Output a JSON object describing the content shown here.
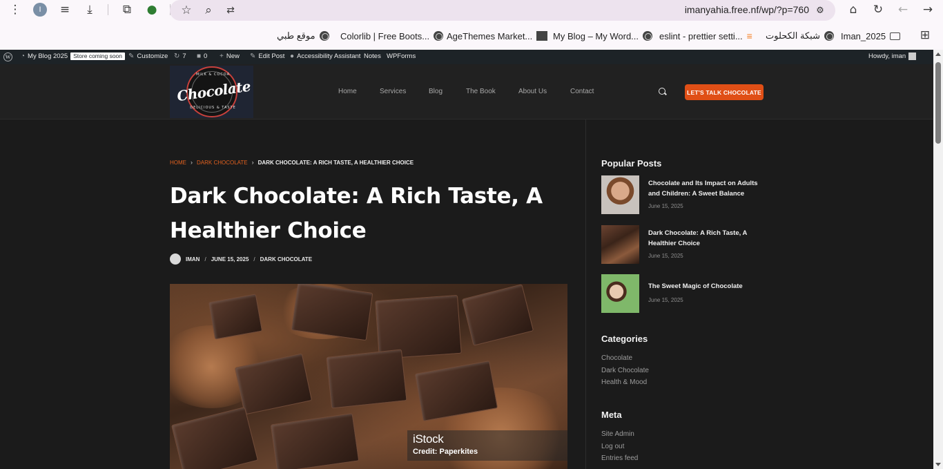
{
  "browser": {
    "profile_initial": "I",
    "url": "imanyahia.free.nf/wp/?p=760",
    "bookmarks": [
      {
        "label": "Iman_2025",
        "icon": "folder-icon"
      },
      {
        "label": "شبكة الكحلوت",
        "icon": "globe-icon"
      },
      {
        "label": "eslint - prettier setti...",
        "icon": "stackoverflow-icon"
      },
      {
        "label": "My Blog – My Word...",
        "icon": "globe-icon"
      },
      {
        "label": "AgeThemes Market...",
        "icon": "square-icon"
      },
      {
        "label": "Colorlib | Free Boots...",
        "icon": "globe-icon"
      },
      {
        "label": "موقع طبي",
        "icon": "globe-icon"
      }
    ]
  },
  "adminbar": {
    "site_name": "My Blog 2025",
    "store_badge": "Store coming soon",
    "customize": "Customize",
    "updates_count": "7",
    "comments_count": "0",
    "new": "New",
    "edit_post": "Edit Post",
    "accessibility": "Accessibility Assistant",
    "notes": "Notes",
    "wpforms": "WPForms",
    "howdy": "Howdy, iman"
  },
  "header": {
    "logo_text": "Chocolate",
    "logo_top": "MILK & COCOA",
    "logo_bottom": "DELICIOUS & TASTE",
    "nav": [
      "Home",
      "Services",
      "Blog",
      "The Book",
      "About Us",
      "Contact"
    ],
    "cta": "LET'S TALK CHOCOLATE"
  },
  "post": {
    "breadcrumb": [
      "HOME",
      "DARK CHOCOLATE",
      "DARK CHOCOLATE: A RICH TASTE, A HEALTHIER CHOICE"
    ],
    "title_line1": "Dark Chocolate: A Rich Taste, A",
    "title_line2": "Healthier Choice",
    "author": "IMAN",
    "date": "JUNE 15, 2025",
    "category": "DARK CHOCOLATE",
    "image_brand": "iStock",
    "image_credit": "Credit: Paperkites"
  },
  "sidebar": {
    "popular_title": "Popular Posts",
    "popular": [
      {
        "title": "Chocolate and Its Impact on Adults and Children: A Sweet Balance",
        "date": "June 15, 2025"
      },
      {
        "title": "Dark Chocolate: A Rich Taste, A Healthier Choice",
        "date": "June 15, 2025"
      },
      {
        "title": "The Sweet Magic of Chocolate",
        "date": "June 15, 2025"
      }
    ],
    "categories_title": "Categories",
    "categories": [
      "Chocolate",
      "Dark Chocolate",
      "Health & Mood"
    ],
    "meta_title": "Meta",
    "meta": [
      "Site Admin",
      "Log out",
      "Entries feed"
    ]
  },
  "colors": {
    "accent": "#e04f16",
    "background": "#1b1b1b",
    "adminbar": "#1d2327"
  }
}
